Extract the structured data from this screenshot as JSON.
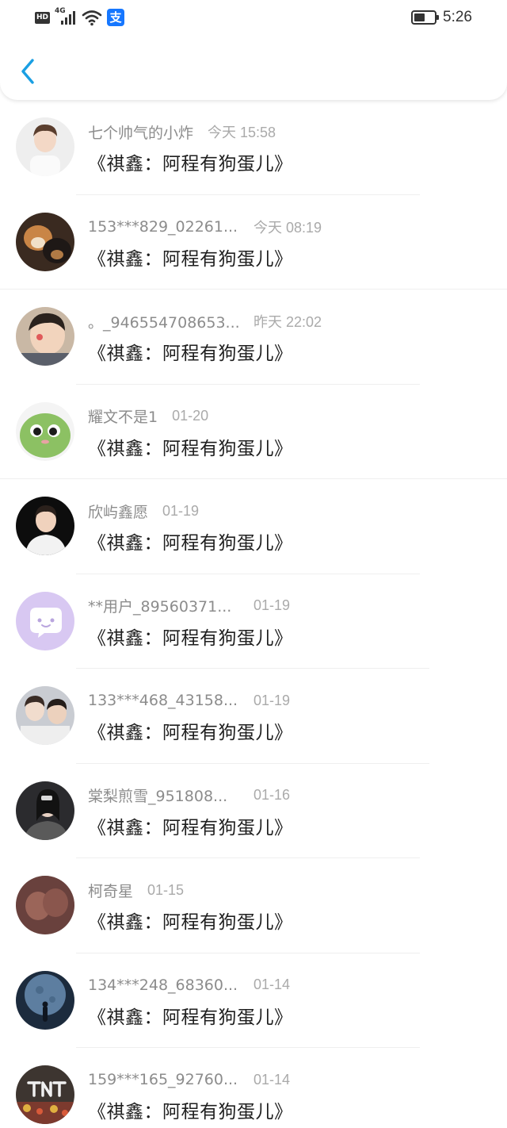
{
  "status_bar": {
    "network_badge": "HD",
    "signal_type": "4G",
    "alipay_glyph": "支",
    "time": "5:26",
    "battery_level": 0.55
  },
  "header": {
    "back_icon": "chevron-left-icon",
    "accent_color": "#1a9fe3"
  },
  "items": [
    {
      "nickname": "七个帅气的小炸",
      "time": "今天 15:58",
      "title": "《祺鑫：阿程有狗蛋儿》"
    },
    {
      "nickname": "153***829_02261...",
      "time": "今天 08:19",
      "title": "《祺鑫：阿程有狗蛋儿》"
    },
    {
      "nickname": "。_946554708653...",
      "time": "昨天 22:02",
      "title": "《祺鑫：阿程有狗蛋儿》"
    },
    {
      "nickname": "耀文不是1",
      "time": "01-20",
      "title": "《祺鑫：阿程有狗蛋儿》"
    },
    {
      "nickname": "欣屿鑫愿",
      "time": "01-19",
      "title": "《祺鑫：阿程有狗蛋儿》"
    },
    {
      "nickname": "**用户_89560371...",
      "time": "01-19",
      "title": "《祺鑫：阿程有狗蛋儿》"
    },
    {
      "nickname": "133***468_43158...",
      "time": "01-19",
      "title": "《祺鑫：阿程有狗蛋儿》"
    },
    {
      "nickname": "棠梨煎雪_951808...",
      "time": "01-16",
      "title": "《祺鑫：阿程有狗蛋儿》"
    },
    {
      "nickname": "柯奇星",
      "time": "01-15",
      "title": "《祺鑫：阿程有狗蛋儿》"
    },
    {
      "nickname": "134***248_68360...",
      "time": "01-14",
      "title": "《祺鑫：阿程有狗蛋儿》"
    },
    {
      "nickname": "159***165_92760...",
      "time": "01-14",
      "title": "《祺鑫：阿程有狗蛋儿》"
    }
  ]
}
